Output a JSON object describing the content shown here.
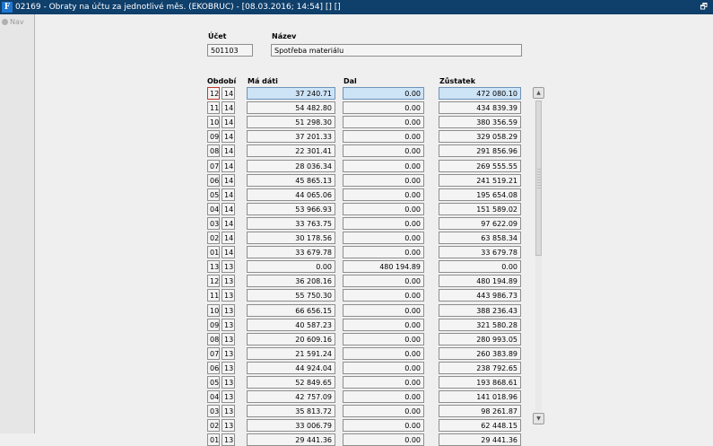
{
  "window": {
    "title": "02169 - Obraty na účtu za jednotlivé měs. (EKOBRUC) - [08.03.2016; 14:54] [] []",
    "restore_glyph": "🗗"
  },
  "sidebar": {
    "nav_label": "Nav"
  },
  "account": {
    "ucet_label": "Účet",
    "ucet_value": "501103",
    "nazev_label": "Název",
    "nazev_value": "Spotřeba materiálu"
  },
  "table": {
    "headers": {
      "obdobi": "Období",
      "ma_dati": "Má dáti",
      "dal": "Dal",
      "zustatek": "Zůstatek"
    },
    "rows": [
      {
        "m": "12",
        "y": "14",
        "md": "37 240.71",
        "dal": "0.00",
        "z": "472 080.10"
      },
      {
        "m": "11",
        "y": "14",
        "md": "54 482.80",
        "dal": "0.00",
        "z": "434 839.39"
      },
      {
        "m": "10",
        "y": "14",
        "md": "51 298.30",
        "dal": "0.00",
        "z": "380 356.59"
      },
      {
        "m": "09",
        "y": "14",
        "md": "37 201.33",
        "dal": "0.00",
        "z": "329 058.29"
      },
      {
        "m": "08",
        "y": "14",
        "md": "22 301.41",
        "dal": "0.00",
        "z": "291 856.96"
      },
      {
        "m": "07",
        "y": "14",
        "md": "28 036.34",
        "dal": "0.00",
        "z": "269 555.55"
      },
      {
        "m": "06",
        "y": "14",
        "md": "45 865.13",
        "dal": "0.00",
        "z": "241 519.21"
      },
      {
        "m": "05",
        "y": "14",
        "md": "44 065.06",
        "dal": "0.00",
        "z": "195 654.08"
      },
      {
        "m": "04",
        "y": "14",
        "md": "53 966.93",
        "dal": "0.00",
        "z": "151 589.02"
      },
      {
        "m": "03",
        "y": "14",
        "md": "33 763.75",
        "dal": "0.00",
        "z": "97 622.09"
      },
      {
        "m": "02",
        "y": "14",
        "md": "30 178.56",
        "dal": "0.00",
        "z": "63 858.34"
      },
      {
        "m": "01",
        "y": "14",
        "md": "33 679.78",
        "dal": "0.00",
        "z": "33 679.78"
      },
      {
        "m": "13",
        "y": "13",
        "md": "0.00",
        "dal": "480 194.89",
        "z": "0.00"
      },
      {
        "m": "12",
        "y": "13",
        "md": "36 208.16",
        "dal": "0.00",
        "z": "480 194.89"
      },
      {
        "m": "11",
        "y": "13",
        "md": "55 750.30",
        "dal": "0.00",
        "z": "443 986.73"
      },
      {
        "m": "10",
        "y": "13",
        "md": "66 656.15",
        "dal": "0.00",
        "z": "388 236.43"
      },
      {
        "m": "09",
        "y": "13",
        "md": "40 587.23",
        "dal": "0.00",
        "z": "321 580.28"
      },
      {
        "m": "08",
        "y": "13",
        "md": "20 609.16",
        "dal": "0.00",
        "z": "280 993.05"
      },
      {
        "m": "07",
        "y": "13",
        "md": "21 591.24",
        "dal": "0.00",
        "z": "260 383.89"
      },
      {
        "m": "06",
        "y": "13",
        "md": "44 924.04",
        "dal": "0.00",
        "z": "238 792.65"
      },
      {
        "m": "05",
        "y": "13",
        "md": "52 849.65",
        "dal": "0.00",
        "z": "193 868.61"
      },
      {
        "m": "04",
        "y": "13",
        "md": "42 757.09",
        "dal": "0.00",
        "z": "141 018.96"
      },
      {
        "m": "03",
        "y": "13",
        "md": "35 813.72",
        "dal": "0.00",
        "z": "98 261.87"
      },
      {
        "m": "02",
        "y": "13",
        "md": "33 006.79",
        "dal": "0.00",
        "z": "62 448.15"
      },
      {
        "m": "01",
        "y": "13",
        "md": "29 441.36",
        "dal": "0.00",
        "z": "29 441.36"
      }
    ]
  },
  "scroll": {
    "visible_fraction": 0.5,
    "position_fraction": 0.0
  }
}
